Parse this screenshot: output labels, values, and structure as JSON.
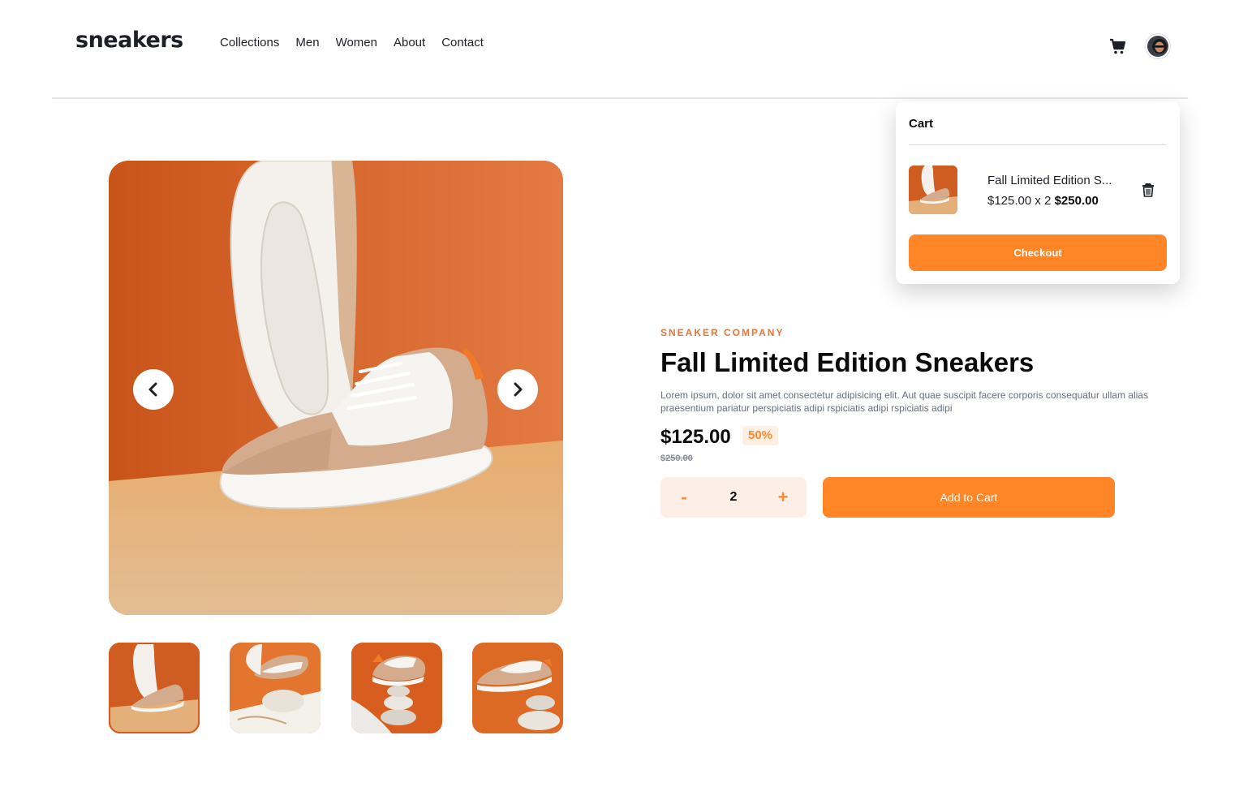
{
  "brand": {
    "logo": "sneakers"
  },
  "nav": {
    "items": [
      "Collections",
      "Men",
      "Women",
      "About",
      "Contact"
    ]
  },
  "header": {
    "cart_icon": "cart-icon",
    "avatar": "user-avatar"
  },
  "gallery": {
    "prev_icon": "chevron-left-icon",
    "next_icon": "chevron-right-icon",
    "thumbnail_count": 4,
    "active_thumbnail": 1
  },
  "product": {
    "company": "SNEAKER COMPANY",
    "title": "Fall Limited Edition Sneakers",
    "description": "Lorem ipsum, dolor sit amet consectetur adipisicing elit. Aut quae suscipit facere corporis consequatur ullam alias praesentium pariatur perspiciatis adipi rspiciatis adipi rspiciatis adipi",
    "price": "$125.00",
    "discount": "50%",
    "original_price": "$250.00",
    "quantity": "2",
    "decrement_label": "-",
    "increment_label": "+",
    "add_to_cart_label": "Add to Cart"
  },
  "cart": {
    "title": "Cart",
    "item": {
      "name": "Fall Limited Edition S...",
      "unit_line": "$125.00 x 2 ",
      "total": "$250.00"
    },
    "delete_icon": "trash-icon",
    "checkout_label": "Checkout"
  },
  "colors": {
    "accent": "#ff8527",
    "accent_pale": "#ffeee2",
    "text_dark": "#1d2026",
    "text_muted": "#68707d"
  }
}
